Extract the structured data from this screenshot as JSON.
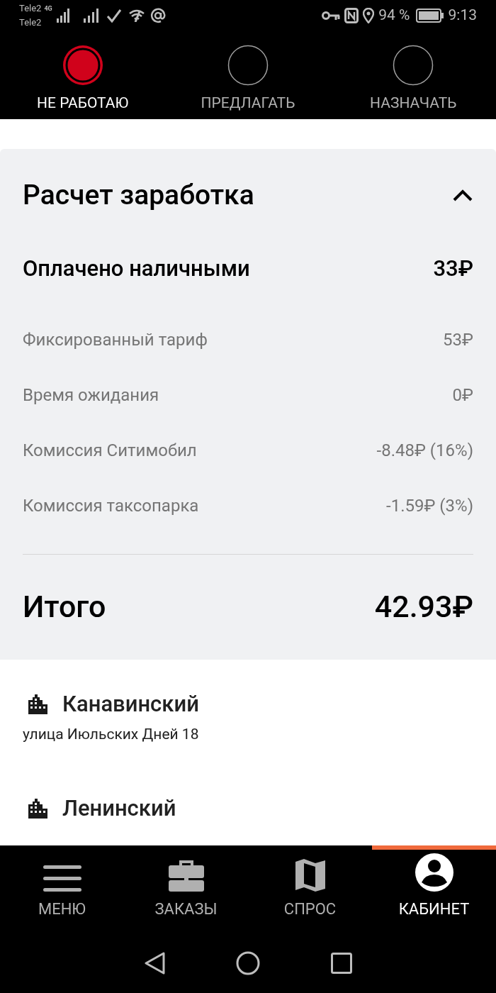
{
  "status_bar": {
    "carriers": [
      "Tele2",
      "Tele2"
    ],
    "network": "4G",
    "battery": "94 %",
    "time": "9:13"
  },
  "modes": [
    {
      "label": "НЕ РАБОТАЮ",
      "selected": true
    },
    {
      "label": "ПРЕДЛАГАТЬ",
      "selected": false
    },
    {
      "label": "НАЗНАЧАТЬ",
      "selected": false
    }
  ],
  "earnings": {
    "title": "Расчет заработка",
    "expanded": true,
    "paid": {
      "label": "Оплачено наличными",
      "value": "33₽"
    },
    "items": [
      {
        "label": "Фиксированный тариф",
        "value": "53₽"
      },
      {
        "label": "Время ожидания",
        "value": "0₽"
      },
      {
        "label": "Комиссия Ситимобил",
        "value": "-8.48₽ (16%)"
      },
      {
        "label": "Комиссия таксопарка",
        "value": "-1.59₽ (3%)"
      }
    ],
    "total": {
      "label": "Итого",
      "value": "42.93₽"
    }
  },
  "addresses": [
    {
      "district": "Канавинский",
      "street": "улица Июльских Дней 18"
    },
    {
      "district": "Ленинский"
    }
  ],
  "tabs": [
    {
      "kind": "menu",
      "label": "МЕНЮ",
      "selected": false
    },
    {
      "kind": "orders",
      "label": "ЗАКАЗЫ",
      "selected": false
    },
    {
      "kind": "demand",
      "label": "СПРОС",
      "selected": false
    },
    {
      "kind": "cabinet",
      "label": "КАБИНЕТ",
      "selected": true
    }
  ]
}
